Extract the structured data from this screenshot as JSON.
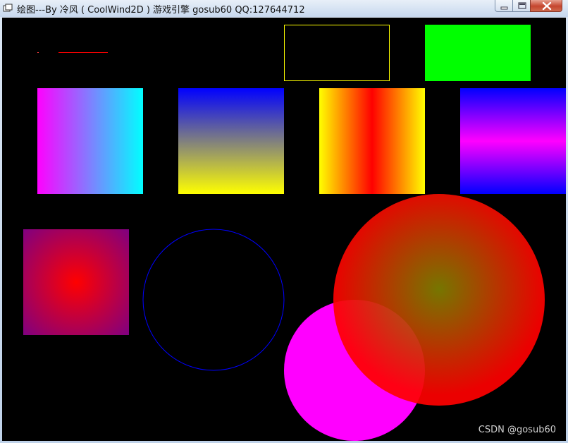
{
  "window": {
    "title": "绘图---By 冷风 ( CoolWind2D ) 游戏引擎 gosub60 QQ:127644712"
  },
  "controls": [
    "minimize-icon",
    "maximize-icon",
    "close-icon"
  ],
  "watermark": "CSDN @gosub60",
  "colors": {
    "canvas_bg": "#000000",
    "rect_outline": "#ffff00",
    "rect_fill": "#00ff00",
    "grad1": [
      "#ff00ff",
      "#00ffff"
    ],
    "grad2": [
      "#0000ff",
      "#ffff00"
    ],
    "grad3": [
      "#ffff00",
      "#ff0000",
      "#ffff00"
    ],
    "grad4": [
      "#0000ff",
      "#ff00ff",
      "#0000ff"
    ],
    "radial_square": [
      "#ff0000",
      "#800080"
    ],
    "circle_outline": "#0000ff",
    "magenta_circle": "#ff00ff",
    "radial_circle": [
      "#808000",
      "#ff0000"
    ]
  }
}
